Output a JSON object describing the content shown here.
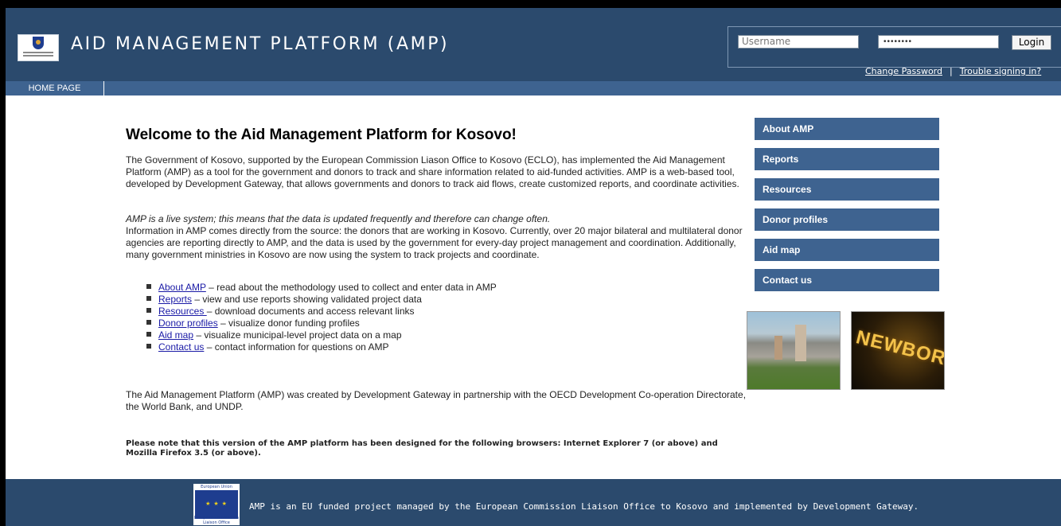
{
  "header": {
    "title": "AID MANAGEMENT PLATFORM (AMP)",
    "logo_icon": "kosovo-crest-logo"
  },
  "login": {
    "username_placeholder": "Username",
    "password_value": "••••••••",
    "login_label": "Login",
    "change_password": "Change Password",
    "separator": "|",
    "trouble": "Trouble signing in?"
  },
  "nav": {
    "home": "HOME PAGE"
  },
  "main": {
    "heading": "Welcome to the Aid Management Platform for Kosovo!",
    "para1": "The Government of Kosovo, supported by the European Commission Liason Office to Kosovo (ECLO), has implemented the Aid Management Platform (AMP) as a tool for the government and donors to track and share information related to aid-funded activities. AMP is a web-based tool, developed by Development Gateway, that allows governments and donors to track aid flows, create customized reports, and coordinate activities.",
    "para2": "AMP is a live system; this means that the data is updated frequently and therefore can change often.",
    "para3": "Information in AMP comes directly from the source: the donors that are working in Kosovo. Currently, over 20 major bilateral and multilateral donor agencies are reporting directly to AMP, and the data is used by the government for every-day project management and coordination. Additionally, many government ministries in Kosovo are now using the system to track projects and coordinate.",
    "bullets": [
      {
        "link": "About AMP",
        "text": " – read about the methodology used to collect and enter data in AMP"
      },
      {
        "link": "Reports",
        "text": " – view and use reports showing validated project data"
      },
      {
        "link": "Resources ",
        "text": "– download documents and access relevant links"
      },
      {
        "link": "Donor profiles",
        "text": " – visualize donor funding profiles"
      },
      {
        "link": "Aid map",
        "text": " – visualize municipal-level project data on a map"
      },
      {
        "link": "Contact us",
        "text": " – contact information for questions on AMP"
      }
    ],
    "para4": "The Aid Management Platform (AMP) was created by Development Gateway in partnership with the OECD Development Co-operation Directorate, the World Bank, and UNDP.",
    "para5": "Please note that this version of the AMP platform has been designed for the following browsers: Internet Explorer 7 (or above) and Mozilla Firefox 3.5 (or above)."
  },
  "sidebar": {
    "items": [
      "About AMP",
      "Reports",
      "Resources",
      "Donor profiles",
      "Aid map",
      "Contact us"
    ],
    "photo_caption": "NEWBORN"
  },
  "footer": {
    "eu_top": "European Union",
    "eu_bottom": "European Commission Liaison Office",
    "text": "AMP is an EU funded project managed by the European Commission Liaison Office to Kosovo and implemented by Development Gateway."
  },
  "colors": {
    "header_bg": "#2b4a6d",
    "nav_bg": "#3e6390",
    "link": "#1a1aa6"
  }
}
